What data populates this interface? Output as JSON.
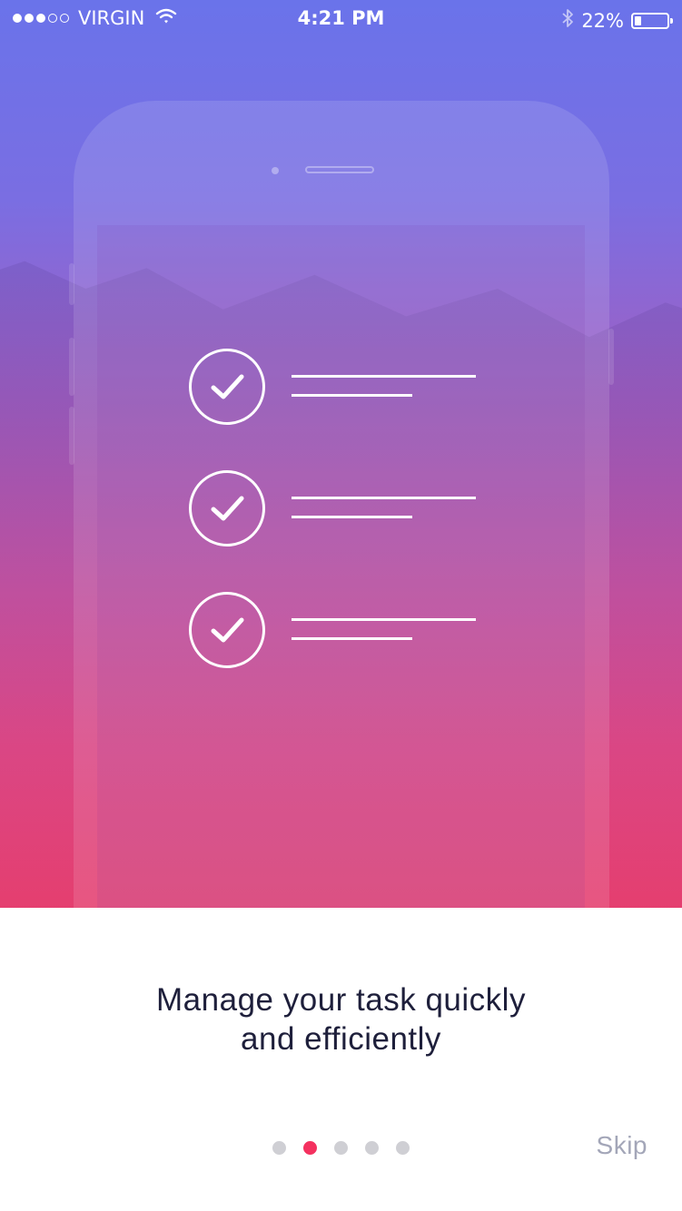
{
  "status_bar": {
    "carrier": "VIRGIN",
    "signal_dots": [
      true,
      true,
      true,
      false,
      false
    ],
    "time": "4:21 PM",
    "battery": "22%",
    "battery_level": 0.22,
    "icons": [
      "wifi-icon",
      "bluetooth-icon",
      "battery-icon"
    ]
  },
  "illustration": {
    "tasks": [
      {
        "icon": "check-icon",
        "checked": true
      },
      {
        "icon": "check-icon",
        "checked": true
      },
      {
        "icon": "check-icon",
        "checked": true
      }
    ]
  },
  "onboarding": {
    "headline_line1": "Manage your task quickly",
    "headline_line2": "and efficiently",
    "page_index": 2,
    "page_count": 5,
    "skip_label": "Skip"
  },
  "colors": {
    "gradient_top": "#6a73ea",
    "gradient_bottom": "#f2416f",
    "accent": "#f4315f",
    "headline": "#1e1f3b",
    "skip": "#a3a6b8",
    "inactive_dot": "#cfcfd4"
  }
}
